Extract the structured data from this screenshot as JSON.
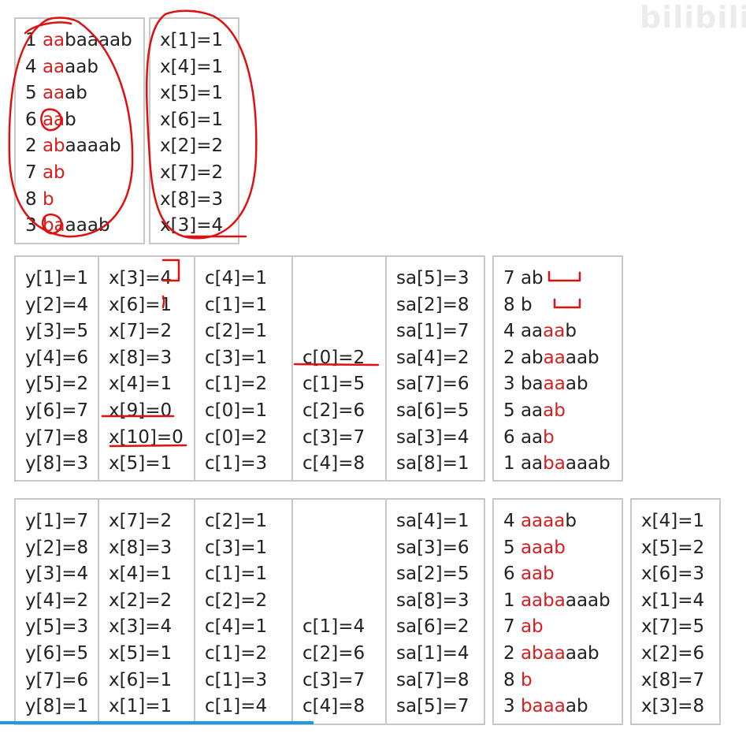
{
  "watermark": "bilibili",
  "accent": "#d42020",
  "progress": 0.42,
  "top": {
    "suffixes": [
      [
        {
          "t": "1 ",
          "c": ""
        },
        {
          "t": "aa",
          "c": "r"
        },
        {
          "t": "baaaab",
          "c": ""
        }
      ],
      [
        {
          "t": "4 ",
          "c": ""
        },
        {
          "t": "aa",
          "c": "r"
        },
        {
          "t": "aab",
          "c": ""
        }
      ],
      [
        {
          "t": "5 ",
          "c": ""
        },
        {
          "t": "aa",
          "c": "r"
        },
        {
          "t": "ab",
          "c": ""
        }
      ],
      [
        {
          "t": "6 ",
          "c": ""
        },
        {
          "t": "aa",
          "c": "r"
        },
        {
          "t": "b",
          "c": ""
        }
      ],
      [
        {
          "t": "2 ",
          "c": ""
        },
        {
          "t": "ab",
          "c": "r"
        },
        {
          "t": "aaaab",
          "c": ""
        }
      ],
      [
        {
          "t": "7 ",
          "c": ""
        },
        {
          "t": "ab",
          "c": "r"
        }
      ],
      [
        {
          "t": "8 ",
          "c": ""
        },
        {
          "t": "b",
          "c": "r"
        }
      ],
      [
        {
          "t": "3 ",
          "c": ""
        },
        {
          "t": "ba",
          "c": "r"
        },
        {
          "t": "aaab",
          "c": ""
        }
      ]
    ],
    "x": [
      "x[1]=1",
      "x[4]=1",
      "x[5]=1",
      "x[6]=1",
      "x[2]=2",
      "x[7]=2",
      "x[8]=3",
      "x[3]=4"
    ]
  },
  "mid": {
    "cols": [
      [
        "y[1]=1",
        "y[2]=4",
        "y[3]=5",
        "y[4]=6",
        "y[5]=2",
        "y[6]=7",
        "y[7]=8",
        "y[8]=3"
      ],
      [
        "x[3]=4",
        "x[6]=1",
        "x[7]=2",
        "x[8]=3",
        "x[4]=1",
        "x[9]=0",
        "x[10]=0",
        "x[5]=1"
      ],
      [
        "c[4]=1",
        "c[1]=1",
        "c[2]=1",
        "c[3]=1",
        "c[1]=2",
        "c[0]=1",
        "c[0]=2",
        "c[1]=3"
      ],
      [
        "",
        "",
        "",
        "c[0]=2",
        "c[1]=5",
        "c[2]=6",
        "c[3]=7",
        "c[4]=8"
      ],
      [
        "sa[5]=3",
        "sa[2]=8",
        "sa[1]=7",
        "sa[4]=2",
        "sa[7]=6",
        "sa[6]=5",
        "sa[3]=4",
        "sa[8]=1"
      ]
    ],
    "suffixes": [
      [
        {
          "t": "7 ab",
          "c": ""
        }
      ],
      [
        {
          "t": "8 b",
          "c": ""
        }
      ],
      [
        {
          "t": "4 aa",
          "c": ""
        },
        {
          "t": "aa",
          "c": "r"
        },
        {
          "t": "b",
          "c": ""
        }
      ],
      [
        {
          "t": "2 ab",
          "c": ""
        },
        {
          "t": "aa",
          "c": "r"
        },
        {
          "t": "aab",
          "c": ""
        }
      ],
      [
        {
          "t": "3 ba",
          "c": ""
        },
        {
          "t": "aa",
          "c": "r"
        },
        {
          "t": "ab",
          "c": ""
        }
      ],
      [
        {
          "t": "5 aa",
          "c": ""
        },
        {
          "t": "ab",
          "c": "r"
        }
      ],
      [
        {
          "t": "6 aa",
          "c": ""
        },
        {
          "t": "b",
          "c": "r"
        }
      ],
      [
        {
          "t": "1 aa",
          "c": ""
        },
        {
          "t": "ba",
          "c": "r"
        },
        {
          "t": "aaab",
          "c": ""
        }
      ]
    ]
  },
  "bottom": {
    "cols": [
      [
        "y[1]=7",
        "y[2]=8",
        "y[3]=4",
        "y[4]=2",
        "y[5]=3",
        "y[6]=5",
        "y[7]=6",
        "y[8]=1"
      ],
      [
        "x[7]=2",
        "x[8]=3",
        "x[4]=1",
        "x[2]=2",
        "x[3]=4",
        "x[5]=1",
        "x[6]=1",
        "x[1]=1"
      ],
      [
        "c[2]=1",
        "c[3]=1",
        "c[1]=1",
        "c[2]=2",
        "c[4]=1",
        "c[1]=2",
        "c[1]=3",
        "c[1]=4"
      ],
      [
        "",
        "",
        "",
        "",
        "c[1]=4",
        "c[2]=6",
        "c[3]=7",
        "c[4]=8"
      ],
      [
        "sa[4]=1",
        "sa[3]=6",
        "sa[2]=5",
        "sa[8]=3",
        "sa[6]=2",
        "sa[1]=4",
        "sa[7]=8",
        "sa[5]=7"
      ]
    ],
    "suffixes": [
      [
        {
          "t": "4 ",
          "c": ""
        },
        {
          "t": "aaaa",
          "c": "r"
        },
        {
          "t": "b",
          "c": ""
        }
      ],
      [
        {
          "t": "5 ",
          "c": ""
        },
        {
          "t": "aaab",
          "c": "r"
        }
      ],
      [
        {
          "t": "6 ",
          "c": ""
        },
        {
          "t": "aab",
          "c": "r"
        }
      ],
      [
        {
          "t": "1 ",
          "c": ""
        },
        {
          "t": "aaba",
          "c": "r"
        },
        {
          "t": "aaab",
          "c": ""
        }
      ],
      [
        {
          "t": "7 ",
          "c": ""
        },
        {
          "t": "ab",
          "c": "r"
        }
      ],
      [
        {
          "t": "2 ",
          "c": ""
        },
        {
          "t": "abaa",
          "c": "r"
        },
        {
          "t": "aab",
          "c": ""
        }
      ],
      [
        {
          "t": "8 ",
          "c": ""
        },
        {
          "t": "b",
          "c": "r"
        }
      ],
      [
        {
          "t": "3 ",
          "c": ""
        },
        {
          "t": "baaa",
          "c": "r"
        },
        {
          "t": "ab",
          "c": ""
        }
      ]
    ],
    "x": [
      "x[4]=1",
      "x[5]=2",
      "x[6]=3",
      "x[1]=4",
      "x[7]=5",
      "x[2]=6",
      "x[8]=7",
      "x[3]=8"
    ]
  }
}
